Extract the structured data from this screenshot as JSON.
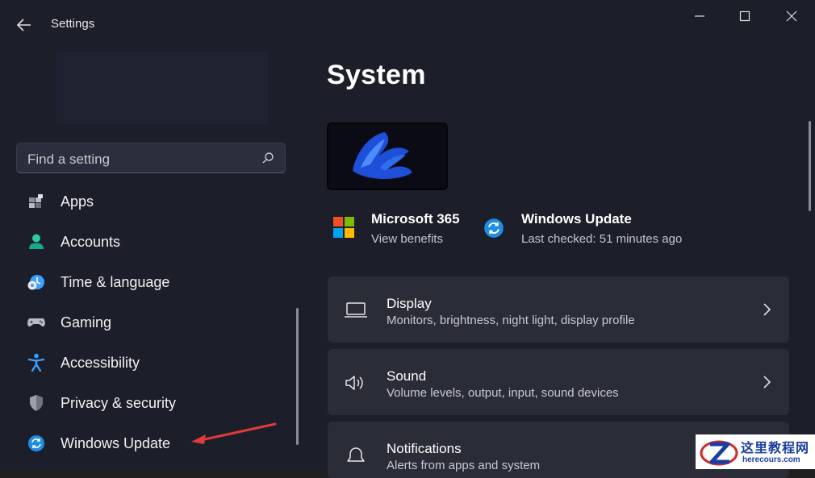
{
  "window": {
    "title": "Settings"
  },
  "search": {
    "placeholder": "Find a setting"
  },
  "sidebar": {
    "items": [
      {
        "label": "Apps",
        "icon": "apps-icon"
      },
      {
        "label": "Accounts",
        "icon": "accounts-icon"
      },
      {
        "label": "Time & language",
        "icon": "time-language-icon"
      },
      {
        "label": "Gaming",
        "icon": "gaming-icon"
      },
      {
        "label": "Accessibility",
        "icon": "accessibility-icon"
      },
      {
        "label": "Privacy & security",
        "icon": "shield-icon"
      },
      {
        "label": "Windows Update",
        "icon": "windows-update-icon"
      }
    ]
  },
  "main": {
    "title": "System",
    "info": [
      {
        "title": "Microsoft 365",
        "subtitle": "View benefits",
        "icon": "microsoft-logo-icon"
      },
      {
        "title": "Windows Update",
        "subtitle": "Last checked: 51 minutes ago",
        "icon": "windows-update-icon"
      }
    ],
    "cards": [
      {
        "title": "Display",
        "subtitle": "Monitors, brightness, night light, display profile",
        "icon": "display-icon"
      },
      {
        "title": "Sound",
        "subtitle": "Volume levels, output, input, sound devices",
        "icon": "speaker-icon"
      },
      {
        "title": "Notifications",
        "subtitle": "Alerts from apps and system",
        "icon": "bell-icon"
      }
    ]
  },
  "watermark": {
    "name": "这里教程网",
    "url": "herecours.com"
  },
  "colors": {
    "background": "#1c1e2a",
    "card": "#2a2c38",
    "accent": "#3aa0ff",
    "arrow": "#e03a3a"
  }
}
